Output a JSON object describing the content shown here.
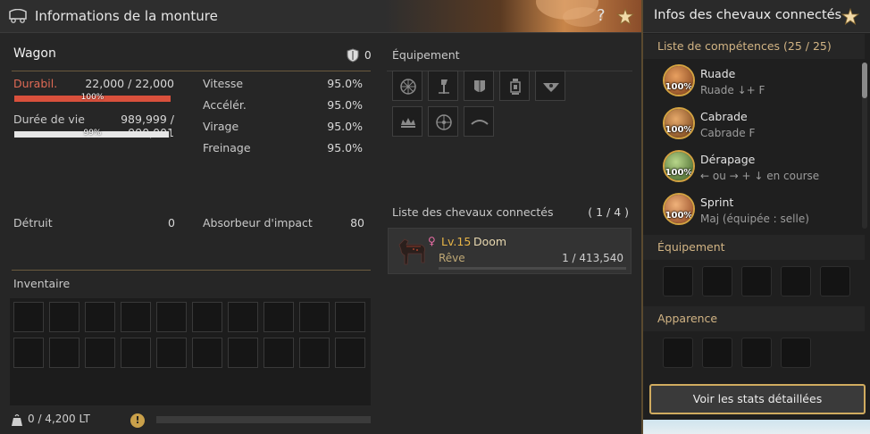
{
  "main_window": {
    "title": "Informations de la monture",
    "help_label": "?"
  },
  "mount": {
    "name": "Wagon",
    "armor_value": "0",
    "durability": {
      "label": "Durabil.",
      "value": "22,000 / 22,000",
      "percent_label": "100%",
      "fill_fraction": 1.0
    },
    "lifespan": {
      "label": "Durée de vie",
      "value": "989,999 / 990,001",
      "percent_label": "99%",
      "fill_fraction": 0.99
    },
    "stats": [
      {
        "label": "Vitesse",
        "value": "95.0%"
      },
      {
        "label": "Accélér.",
        "value": "95.0%"
      },
      {
        "label": "Virage",
        "value": "95.0%"
      },
      {
        "label": "Freinage",
        "value": "95.0%"
      }
    ],
    "destroyed": {
      "label": "Détruit",
      "value": "0"
    },
    "impact_absorber": {
      "label": "Absorbeur d'impact",
      "value": "80"
    }
  },
  "equipment": {
    "heading": "Équipement",
    "slot_icons": [
      "wheel-icon",
      "axe-icon",
      "armor-plate-icon",
      "lantern-icon",
      "emblem-icon",
      "crown-icon",
      "wheel-spoke-icon",
      "yoke-icon"
    ]
  },
  "inventory": {
    "heading": "Inventaire",
    "weight": "0 / 4,200 LT",
    "warning_symbol": "!",
    "weight_fill_fraction": 0.0
  },
  "connected_horses": {
    "heading": "Liste des chevaux connectés",
    "count": "( 1 / 4 )",
    "horses": [
      {
        "gender_symbol": "♀",
        "level": "Lv.15",
        "name": "Doom",
        "state": "Rêve",
        "xp": "1 / 413,540",
        "xp_fraction": 0.0
      }
    ]
  },
  "side_panel": {
    "title": "Infos des chevaux connectés",
    "skills_heading": "Liste de compétences (25 / 25)",
    "skills": [
      {
        "name": "Ruade",
        "keys": "Ruade ↓+ F",
        "percent": "100%",
        "color": "#c0662e"
      },
      {
        "name": "Cabrade",
        "keys": "Cabrade F",
        "percent": "100%",
        "color": "#b56a2a"
      },
      {
        "name": "Dérapage",
        "keys": "← ou → + ↓ en course",
        "percent": "100%",
        "color": "#6a9a4a"
      },
      {
        "name": "Sprint",
        "keys": "Maj (équipée : selle)",
        "percent": "100%",
        "color": "#c87a3e"
      }
    ],
    "equipment_heading": "Équipement",
    "appearance_heading": "Apparence",
    "stats_button": "Voir les stats détaillées"
  },
  "colors": {
    "accent_gold": "#d0ab5f",
    "durability_red": "#d9503c",
    "lifespan_white": "#e6e6e6",
    "section_gold": "#d2b484"
  }
}
